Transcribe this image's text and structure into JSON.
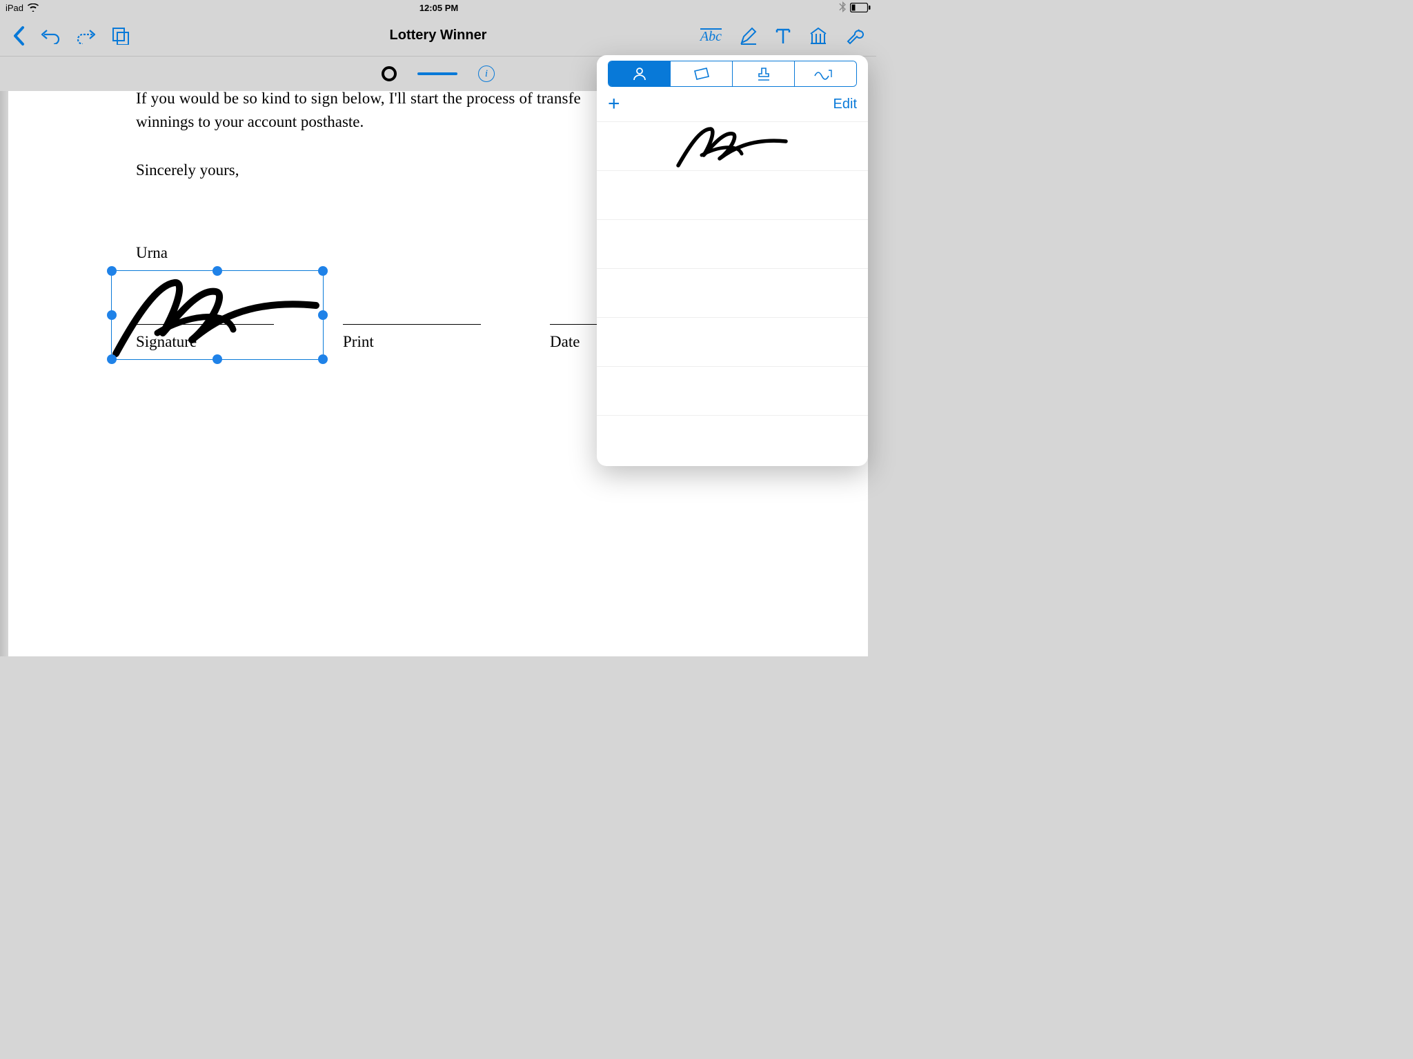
{
  "status_bar": {
    "device": "iPad",
    "time": "12:05 PM"
  },
  "toolbar": {
    "title": "Lottery Winner",
    "abc_label": "Abc"
  },
  "subtoolbar": {
    "info_glyph": "i"
  },
  "document": {
    "line1": "If you would be so kind to sign below, I'll start the process of transfe",
    "line2": "winnings to your account posthaste.",
    "sincerely": "Sincerely yours,",
    "name": "Urna",
    "fields": {
      "signature": "Signature",
      "print": "Print",
      "date": "Date"
    }
  },
  "popover": {
    "add_glyph": "+",
    "edit_label": "Edit"
  }
}
